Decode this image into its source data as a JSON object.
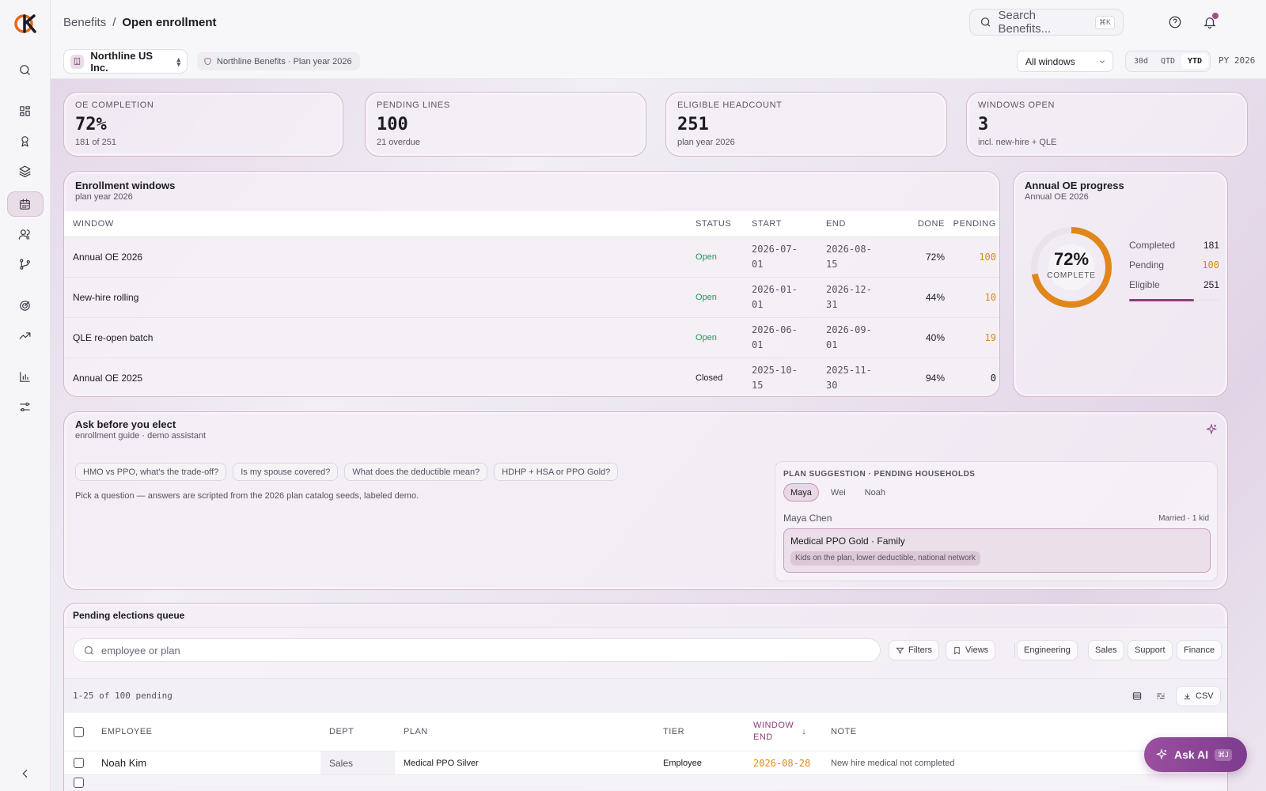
{
  "breadcrumb": {
    "parent": "Benefits",
    "separator": "/",
    "current": "Open enrollment"
  },
  "search": {
    "placeholder": "Search Benefits...",
    "shortcut": "⌘K"
  },
  "subbar": {
    "org": "Northline US Inc.",
    "plan_chip": "Northline Benefits · Plan year 2026",
    "window_select": "All windows",
    "ranges": [
      "30d",
      "QTD",
      "YTD"
    ],
    "active_range": "YTD",
    "plan_year": "PY 2026"
  },
  "kpis": [
    {
      "label": "OE COMPLETION",
      "value": "72%",
      "sub": "181 of 251"
    },
    {
      "label": "PENDING LINES",
      "value": "100",
      "sub": "21 overdue"
    },
    {
      "label": "ELIGIBLE HEADCOUNT",
      "value": "251",
      "sub": "plan year 2026"
    },
    {
      "label": "WINDOWS OPEN",
      "value": "3",
      "sub": "incl. new-hire + QLE"
    }
  ],
  "enrollment_windows": {
    "title": "Enrollment windows",
    "subtitle": "plan year 2026",
    "columns": {
      "window": "WINDOW",
      "status": "STATUS",
      "start": "START",
      "end": "END",
      "done": "DONE",
      "pending": "PENDING"
    },
    "rows": [
      {
        "window": "Annual OE 2026",
        "status": "Open",
        "start_a": "2026-07-",
        "start_b": "01",
        "end_a": "2026-08-",
        "end_b": "15",
        "done": "72%",
        "pending": "100"
      },
      {
        "window": "New-hire rolling",
        "status": "Open",
        "start_a": "2026-01-",
        "start_b": "01",
        "end_a": "2026-12-",
        "end_b": "31",
        "done": "44%",
        "pending": "10"
      },
      {
        "window": "QLE re-open batch",
        "status": "Open",
        "start_a": "2026-06-",
        "start_b": "01",
        "end_a": "2026-09-",
        "end_b": "01",
        "done": "40%",
        "pending": "19"
      },
      {
        "window": "Annual OE 2025",
        "status": "Closed",
        "start_a": "2025-10-",
        "start_b": "15",
        "end_a": "2025-11-",
        "end_b": "30",
        "done": "94%",
        "pending": "0"
      }
    ]
  },
  "oe_progress": {
    "title": "Annual OE progress",
    "subtitle": "Annual OE 2026",
    "percent_label": "72%",
    "complete_label": "COMPLETE",
    "fraction": 0.72,
    "legend": [
      {
        "label": "Completed",
        "value": "181"
      },
      {
        "label": "Pending",
        "value": "100"
      },
      {
        "label": "Eligible",
        "value": "251"
      }
    ],
    "ring_color": "#e0861b",
    "bar_color": "#8a3e78"
  },
  "assistant": {
    "title": "Ask before you elect",
    "subtitle": "enrollment guide · demo assistant",
    "questions": [
      "HMO vs PPO, what's the trade-off?",
      "Is my spouse covered?",
      "What does the deductible mean?",
      "HDHP + HSA or PPO Gold?"
    ],
    "hint": "Pick a question — answers are scripted from the 2026 plan catalog seeds, labeled demo.",
    "suggestion": {
      "title": "PLAN SUGGESTION · PENDING HOUSEHOLDS",
      "tabs": [
        "Maya",
        "Wei",
        "Noah"
      ],
      "active_tab": "Maya",
      "name": "Maya Chen",
      "meta": "Married · 1 kid",
      "plan": "Medical PPO Gold · Family",
      "reason": "Kids on the plan, lower deductible, national network"
    }
  },
  "queue": {
    "title": "Pending elections queue",
    "search_placeholder": "employee or plan",
    "filters_label": "Filters",
    "views_label": "Views",
    "departments": [
      "Engineering",
      "Sales",
      "Support",
      "Finance"
    ],
    "count_text": "1-25 of 100 pending",
    "csv_label": "CSV",
    "columns": {
      "employee": "EMPLOYEE",
      "dept": "DEPT",
      "plan": "PLAN",
      "tier": "TIER",
      "window_end_a": "WINDOW",
      "window_end_b": "END",
      "sort": "↓",
      "note": "NOTE"
    },
    "rows": [
      {
        "employee": "Noah Kim",
        "dept": "Sales",
        "plan": "Medical PPO Silver",
        "tier": "Employee",
        "window_end": "2026-08-28",
        "note": "New hire medical not completed"
      }
    ]
  },
  "ask_ai": {
    "label": "Ask AI",
    "shortcut": "⌘J"
  }
}
